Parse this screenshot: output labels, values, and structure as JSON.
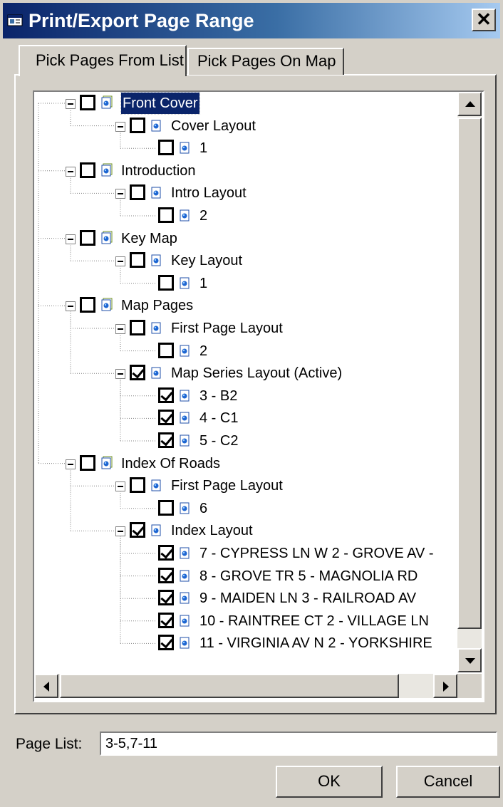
{
  "window": {
    "title": "Print/Export Page Range",
    "close_label": "✕"
  },
  "tabs": [
    {
      "label": "Pick Pages From List",
      "active": true
    },
    {
      "label": "Pick Pages On Map",
      "active": false
    }
  ],
  "tree": [
    {
      "label": "Front Cover",
      "level": 0,
      "checked": false,
      "selected": true,
      "children": [
        {
          "label": "Cover Layout",
          "level": 1,
          "checked": false,
          "children": [
            {
              "label": "1",
              "level": 2,
              "checked": false
            }
          ]
        }
      ]
    },
    {
      "label": "Introduction",
      "level": 0,
      "checked": false,
      "children": [
        {
          "label": "Intro Layout",
          "level": 1,
          "checked": false,
          "children": [
            {
              "label": "2",
              "level": 2,
              "checked": false
            }
          ]
        }
      ]
    },
    {
      "label": "Key Map",
      "level": 0,
      "checked": false,
      "children": [
        {
          "label": "Key Layout",
          "level": 1,
          "checked": false,
          "children": [
            {
              "label": "1",
              "level": 2,
              "checked": false
            }
          ]
        }
      ]
    },
    {
      "label": "Map Pages",
      "level": 0,
      "checked": false,
      "children": [
        {
          "label": "First Page Layout",
          "level": 1,
          "checked": false,
          "children": [
            {
              "label": "2",
              "level": 2,
              "checked": false
            }
          ]
        },
        {
          "label": "Map Series Layout (Active)",
          "level": 1,
          "checked": true,
          "children": [
            {
              "label": "3 - B2",
              "level": 2,
              "checked": true
            },
            {
              "label": "4 - C1",
              "level": 2,
              "checked": true
            },
            {
              "label": "5 - C2",
              "level": 2,
              "checked": true
            }
          ]
        }
      ]
    },
    {
      "label": "Index Of Roads",
      "level": 0,
      "checked": false,
      "children": [
        {
          "label": "First Page Layout",
          "level": 1,
          "checked": false,
          "children": [
            {
              "label": "6",
              "level": 2,
              "checked": false
            }
          ]
        },
        {
          "label": "Index Layout",
          "level": 1,
          "checked": true,
          "children": [
            {
              "label": "7 -  CYPRESS LN W 2 -  GROVE AV  -",
              "level": 2,
              "checked": true
            },
            {
              "label": "8 -  GROVE TR   5 -  MAGNOLIA RD",
              "level": 2,
              "checked": true
            },
            {
              "label": "9 -  MAIDEN LN   3 -  RAILROAD AV",
              "level": 2,
              "checked": true
            },
            {
              "label": "10 -  RAINTREE CT   2 -  VILLAGE LN",
              "level": 2,
              "checked": true
            },
            {
              "label": "11 -  VIRGINIA AV N 2 -  YORKSHIRE",
              "level": 2,
              "checked": true
            }
          ]
        }
      ]
    }
  ],
  "page_list": {
    "label": "Page List:",
    "value": "3-5,7-11"
  },
  "buttons": {
    "ok": "OK",
    "cancel": "Cancel"
  },
  "icons": {
    "app": "printer-window-icon",
    "group": "document-group-icon",
    "page": "page-icon",
    "expander": "collapse-minus-icon"
  }
}
